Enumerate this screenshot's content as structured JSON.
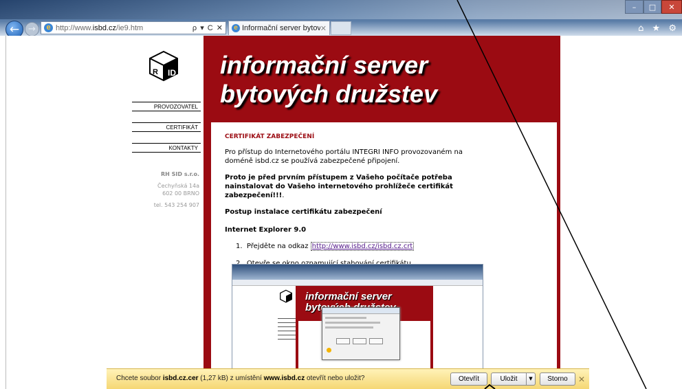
{
  "browser": {
    "address_prefix": "http://www.",
    "address_domain": "isbd.cz",
    "address_path": "/ie9.htm",
    "address_tools": "ρ ▾ C ✕",
    "tab_title": "Informační server bytových...",
    "tab_close": "✕",
    "right_tools": "⌂ ★ ⚙",
    "win_min": "–",
    "win_max": "□",
    "win_close": "✕",
    "back": "←",
    "forward": "→"
  },
  "site": {
    "header_line1": "informační server",
    "header_line2": "bytových družstev",
    "nav": [
      {
        "label": "PROVOZOVATEL"
      },
      {
        "label": "CERTIFIKÁT"
      },
      {
        "label": "KONTAKTY"
      }
    ],
    "company": "RH SID s.r.o.",
    "street": "Čechyňská 14a",
    "city": "602 00 BRNO",
    "phone": "tel. 543 254 907"
  },
  "main": {
    "heading": "CERTIFIKÁT ZABEZPEČENÍ",
    "p1_line1": "Pro přístup do Internetového portálu INTEGRI INFO provozovaném na",
    "p1_line2": "doméně isbd.cz se používá zabezpečené připojení.",
    "bold_line1": "Proto je před prvním přístupem z Vašeho počítače potřeba",
    "bold_line2": "nainstalovat do Vašeho internetového prohlížeče certifikát",
    "bold_line3": "zabezpečení!!!",
    "bold_line3_tail": ".",
    "steps_heading": "Postup instalace certifikátu zabezpečení",
    "browser_heading": "Internet Explorer 9.0",
    "step1_num": "1.",
    "step1_text": "Přejděte na odkaz ",
    "step1_link": "http://www.isbd.cz/isbd.cz.crt",
    "step2_num": "2.",
    "step2_text": "Otevře se okno oznamující stahování certifikátu.",
    "shot_title1": "informační server",
    "shot_title2": "bytových družstev"
  },
  "download_bar": {
    "text_pre": "Chcete soubor ",
    "file": "isbd.cz.cer",
    "size": " (1,27 kB) z umístění ",
    "source": "www.isbd.cz",
    "text_post": " otevřít nebo uložit?",
    "open_label": "Otevřít",
    "save_label": "Uložit",
    "save_arrow": "▼",
    "cancel_label": "Storno",
    "close": "✕"
  }
}
